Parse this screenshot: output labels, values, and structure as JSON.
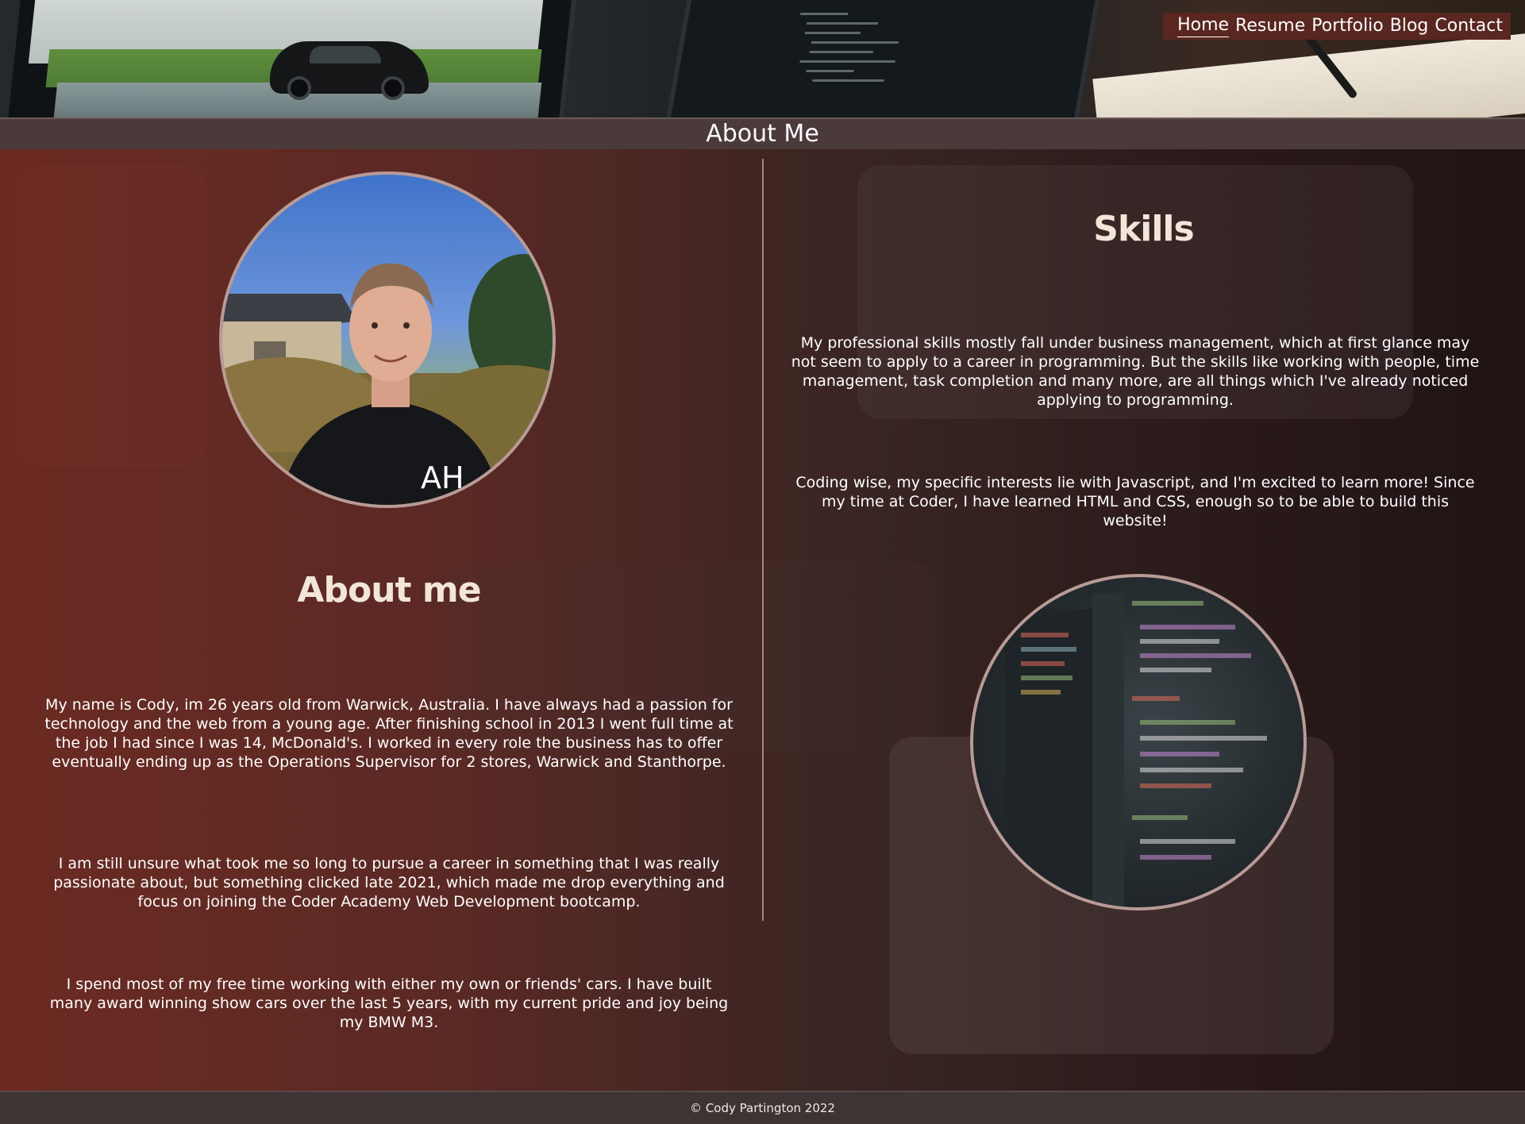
{
  "nav": {
    "items": [
      {
        "label": "Home"
      },
      {
        "label": "Resume"
      },
      {
        "label": "Portfolio"
      },
      {
        "label": "Blog"
      },
      {
        "label": "Contact"
      }
    ],
    "active": "Home"
  },
  "page": {
    "title": "About Me"
  },
  "about": {
    "heading": "About me",
    "paragraphs": [
      "My name is Cody, im 26 years old from Warwick, Australia. I have always had a passion for technology and the web from a young age. After finishing school in 2013 I went full time at the job I had since I was 14, McDonald's. I worked in every role the business has to offer eventually ending up as the Operations Supervisor for 2 stores, Warwick and Stanthorpe.",
      "I am still unsure what took me so long to pursue a career in something that I was really passionate about, but something clicked late 2021, which made me drop everything and focus on joining the Coder Academy Web Development bootcamp.",
      "I spend most of my free time working with either my own or friends' cars. I have built many award winning show cars over the last 5 years, with my current pride and joy being my BMW M3."
    ]
  },
  "skills": {
    "heading": "Skills",
    "paragraphs": [
      "My professional skills mostly fall under business management, which at first glance may not seem to apply to a career in programming. But the skills like working with people, time management, task completion and many more, are all things which I've already noticed applying to programming.",
      "Coding wise, my specific interests lie with Javascript, and I'm excited to learn more! Since my time at Coder, I have learned HTML and CSS, enough so to be able to build this website!"
    ]
  },
  "footer": {
    "copyright": "© Cody Partington 2022"
  }
}
